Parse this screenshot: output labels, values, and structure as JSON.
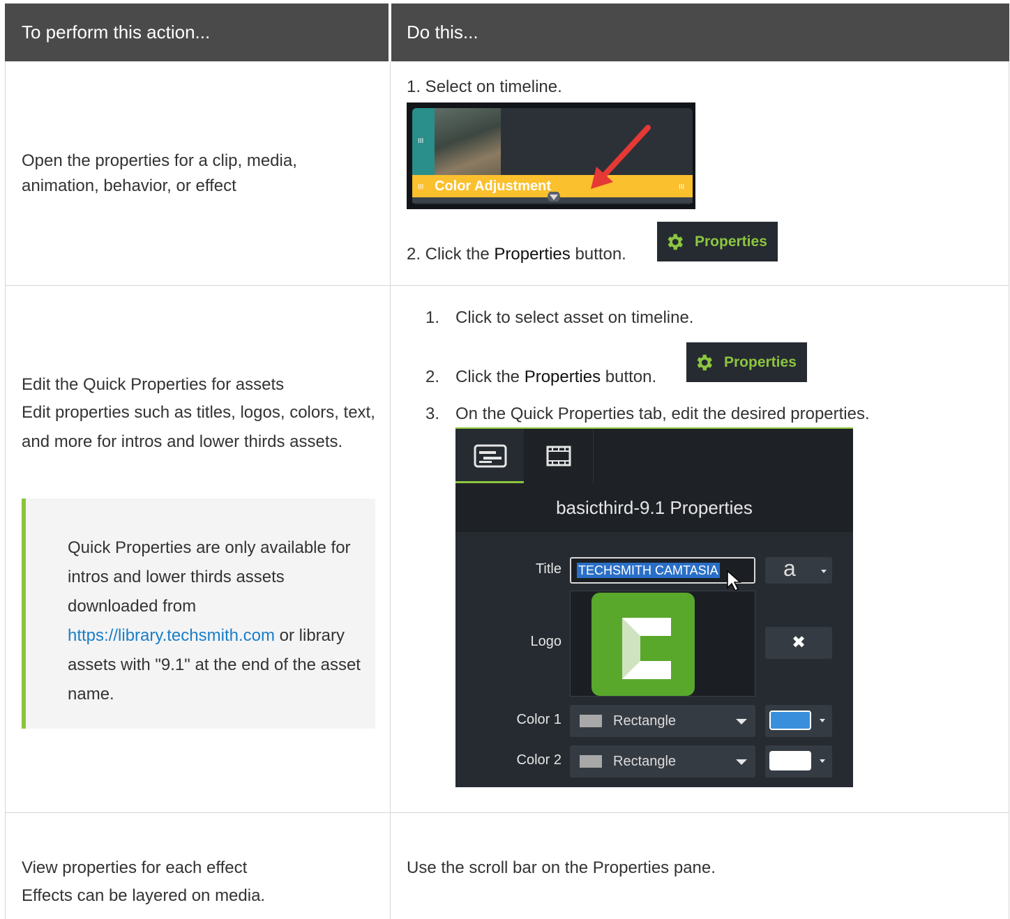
{
  "header": {
    "col1": "To perform this action...",
    "col2": "Do this..."
  },
  "row1": {
    "action": "Open the properties for a clip, media, animation, behavior, or effect",
    "step1": "1. Select on timeline.",
    "timeline_clip_label": "Color Adjustment",
    "step2_prefix": "2. Click the ",
    "step2_bold": "Properties",
    "step2_suffix": " button.",
    "properties_button_label": "Properties"
  },
  "row2": {
    "action_title": "Edit the Quick Properties for assets",
    "action_desc": "Edit properties such as titles, logos, colors, text, and more for intros and lower thirds assets.",
    "note_before_link": "Quick Properties are only available for intros and lower thirds assets downloaded from ",
    "note_link": "https://library.techsmith.com",
    "note_after_link": " or library assets with \"9.1\" at the end of the asset name.",
    "steps": [
      {
        "num": "1.",
        "text": "Click to select asset on timeline."
      },
      {
        "num": "2.",
        "prefix": "Click the ",
        "bold": "Properties",
        "suffix": " button."
      },
      {
        "num": "3.",
        "text": "On the Quick Properties tab, edit the desired properties."
      }
    ],
    "properties_button_label": "Properties",
    "panel": {
      "title": "basicthird-9.1 Properties",
      "title_label": "Title",
      "title_value": "TECHSMITH CAMTASIA",
      "font_glyph": "a",
      "logo_label": "Logo",
      "remove_glyph": "✖",
      "color1_label": "Color 1",
      "color1_shape": "Rectangle",
      "color1_value": "#3a8fdc",
      "color2_label": "Color 2",
      "color2_shape": "Rectangle",
      "color2_value": "#ffffff"
    }
  },
  "row3": {
    "action_title": "View properties for each effect",
    "action_desc": "Effects can be layered on media.",
    "instruction": "Use the scroll bar on the Properties pane."
  },
  "colors": {
    "header_bg": "#4a4a4a",
    "accent_green": "#8cc43c",
    "link": "#1a7ec8"
  }
}
